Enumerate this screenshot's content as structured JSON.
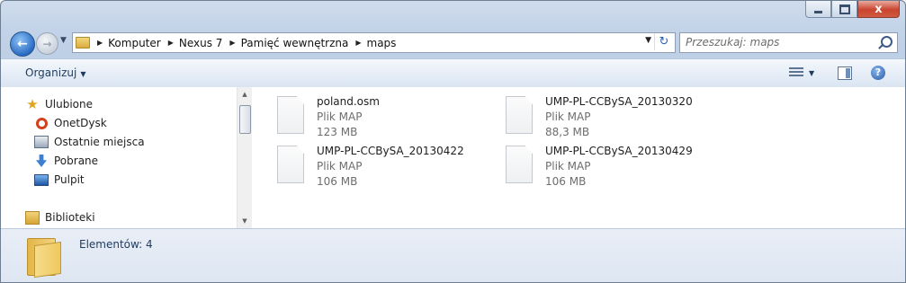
{
  "window": {
    "caption_buttons": [
      "minimize",
      "maximize",
      "close"
    ],
    "close_glyph": "x"
  },
  "nav": {
    "back_icon": "back-arrow-icon",
    "forward_icon": "forward-arrow-icon"
  },
  "address": {
    "breadcrumbs": [
      "Komputer",
      "Nexus 7",
      "Pamięć wewnętrzna",
      "maps"
    ]
  },
  "search": {
    "placeholder": "Przeszukaj: maps"
  },
  "toolbar": {
    "organize_label": "Organizuj"
  },
  "sidebar": {
    "items": [
      {
        "label": "Ulubione",
        "icon": "star-icon"
      },
      {
        "label": "OnetDysk",
        "icon": "onetdysk-icon"
      },
      {
        "label": "Ostatnie miejsca",
        "icon": "recent-places-icon"
      },
      {
        "label": "Pobrane",
        "icon": "downloads-icon"
      },
      {
        "label": "Pulpit",
        "icon": "desktop-icon"
      },
      {
        "label": "Biblioteki",
        "icon": "libraries-icon"
      }
    ]
  },
  "files": [
    {
      "name": "poland.osm",
      "type": "Plik MAP",
      "size": "123 MB"
    },
    {
      "name": "UMP-PL-CCBySA_20130320",
      "type": "Plik MAP",
      "size": "88,3 MB"
    },
    {
      "name": "UMP-PL-CCBySA_20130422",
      "type": "Plik MAP",
      "size": "106 MB"
    },
    {
      "name": "UMP-PL-CCBySA_20130429",
      "type": "Plik MAP",
      "size": "106 MB"
    }
  ],
  "details": {
    "count_label": "Elementów: 4"
  },
  "colors": {
    "accent": "#2b6cc4",
    "frame": "#c3d3e8",
    "close": "#c9452f"
  }
}
